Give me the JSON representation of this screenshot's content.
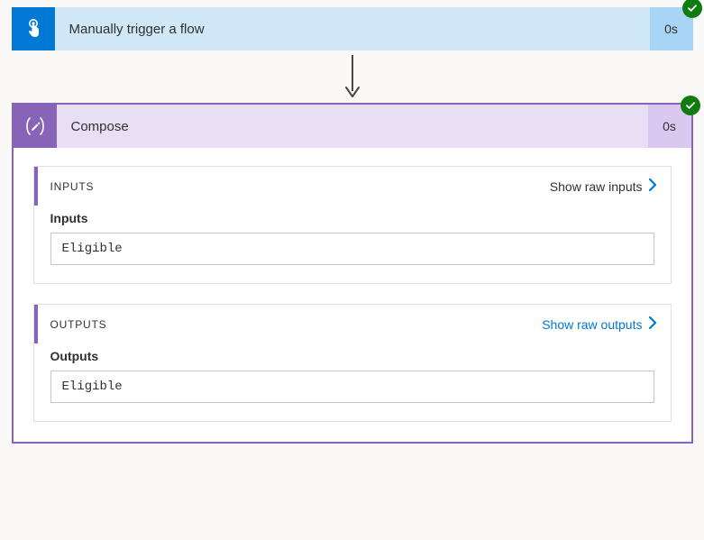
{
  "trigger": {
    "title": "Manually trigger a flow",
    "duration": "0s"
  },
  "compose": {
    "title": "Compose",
    "duration": "0s",
    "inputs": {
      "section_label": "INPUTS",
      "show_raw_label": "Show raw inputs",
      "field_label": "Inputs",
      "value": "Eligible"
    },
    "outputs": {
      "section_label": "OUTPUTS",
      "show_raw_label": "Show raw outputs",
      "field_label": "Outputs",
      "value": "Eligible"
    }
  }
}
